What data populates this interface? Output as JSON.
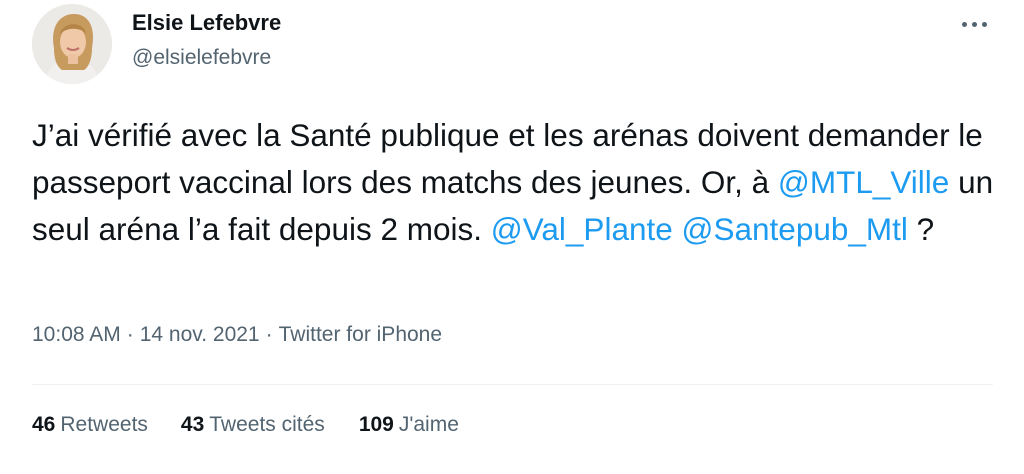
{
  "author": {
    "name": "Elsie Lefebvre",
    "handle": "@elsielefebvre"
  },
  "icons": {
    "more": "more-horizontal-icon",
    "avatar": "profile-photo"
  },
  "tweet": {
    "segments": [
      {
        "text": "J’ai vérifié avec la Santé publique et les arénas doivent demander le passeport vaccinal lors des matchs des jeunes. Or, à ",
        "type": "text"
      },
      {
        "text": "@MTL_Ville",
        "type": "mention"
      },
      {
        "text": " un seul aréna l’a fait depuis 2 mois. ",
        "type": "text"
      },
      {
        "text": "@Val_Plante",
        "type": "mention"
      },
      {
        "text": " ",
        "type": "text"
      },
      {
        "text": "@Santepub_Mtl",
        "type": "mention"
      },
      {
        "text": " ?",
        "type": "text"
      }
    ]
  },
  "meta": {
    "time": "10:08 AM",
    "separator": "·",
    "date": "14 nov. 2021",
    "source": "Twitter for iPhone"
  },
  "stats": {
    "retweets": {
      "count": "46",
      "label": "Retweets"
    },
    "quotes": {
      "count": "43",
      "label": "Tweets cités"
    },
    "likes": {
      "count": "109",
      "label": "J'aime"
    }
  },
  "colors": {
    "text": "#0f1419",
    "secondary": "#536471",
    "link": "#1d9bf0",
    "divider": "#eff3f4"
  }
}
